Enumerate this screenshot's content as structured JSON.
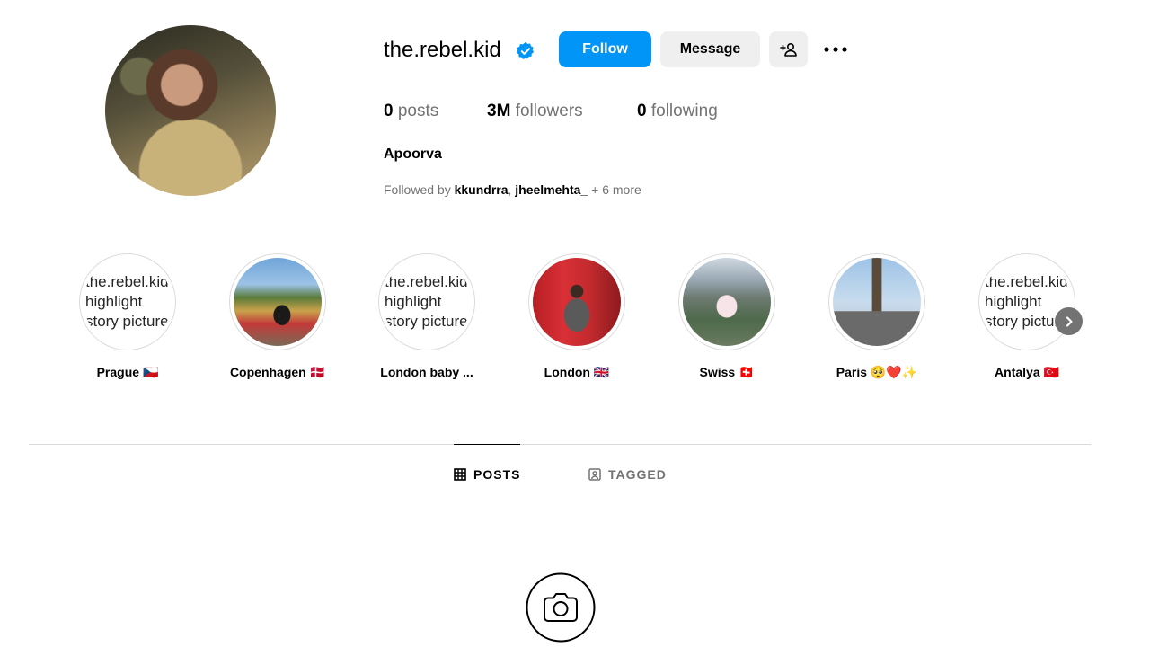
{
  "profile": {
    "username": "the.rebel.kid",
    "follow_label": "Follow",
    "message_label": "Message",
    "posts_count": "0",
    "posts_label": "posts",
    "followers_count": "3M",
    "followers_label": "followers",
    "following_count": "0",
    "following_label": "following",
    "full_name": "Apoorva",
    "followed_by_prefix": "Followed by",
    "followed_by_user1": "kkundrra",
    "followed_by_sep": ",",
    "followed_by_user2": "jheelmehta_",
    "followed_by_more": "+ 6 more"
  },
  "broken_image_alt": [
    "the.rebel.kid",
    "highlight",
    "story picture"
  ],
  "highlights": [
    {
      "label": "Prague 🇨🇿"
    },
    {
      "label": "Copenhagen 🇩🇰"
    },
    {
      "label": "London baby ..."
    },
    {
      "label": "London 🇬🇧"
    },
    {
      "label": "Swiss 🇨🇭"
    },
    {
      "label": "Paris 🥺❤️✨"
    },
    {
      "label": "Antalya 🇹🇷"
    }
  ],
  "tabs": {
    "posts": "POSTS",
    "tagged": "TAGGED"
  },
  "colors": {
    "accent": "#0095f6",
    "secondary_bg": "#efefef",
    "muted_text": "#737373",
    "divider": "#dbdbdb"
  },
  "icons": {
    "verified": "verified-badge-icon",
    "add_user": "add-user-icon",
    "more": "more-options-icon",
    "next": "chevron-right-icon",
    "posts_tab": "grid-icon",
    "tagged_tab": "tagged-user-icon",
    "empty_state": "camera-icon"
  }
}
